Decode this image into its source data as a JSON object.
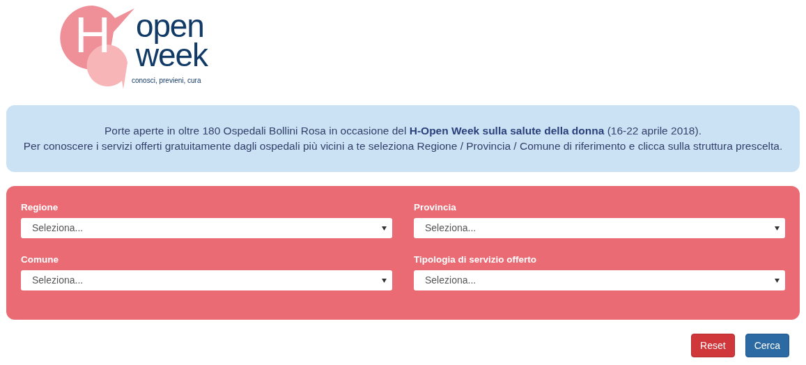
{
  "logo": {
    "letter": "H",
    "word_1": "open",
    "word_2": "week",
    "tagline": "conosci, previeni, cura"
  },
  "notice": {
    "lines": [
      "Porte aperte in oltre 180 Ospedali Bollini Rosa in occasione del **H-Open Week sulla salute della donna** (16-22 aprile 2018).",
      "Per conoscere i servizi offerti gratuitamente dagli ospedali più vicini a te seleziona Regione / Provincia / Comune di riferimento e clicca sulla struttura prescelta."
    ]
  },
  "filters": [
    {
      "label": "Regione",
      "value": "Seleziona..."
    },
    {
      "label": "Provincia",
      "value": "Seleziona..."
    },
    {
      "label": "Comune",
      "value": "Seleziona..."
    },
    {
      "label": "Tipologia di servizio offerto",
      "value": "Seleziona..."
    }
  ],
  "buttons": [
    {
      "label": "Reset",
      "kind": "danger"
    },
    {
      "label": "Cerca",
      "kind": "primary"
    }
  ]
}
